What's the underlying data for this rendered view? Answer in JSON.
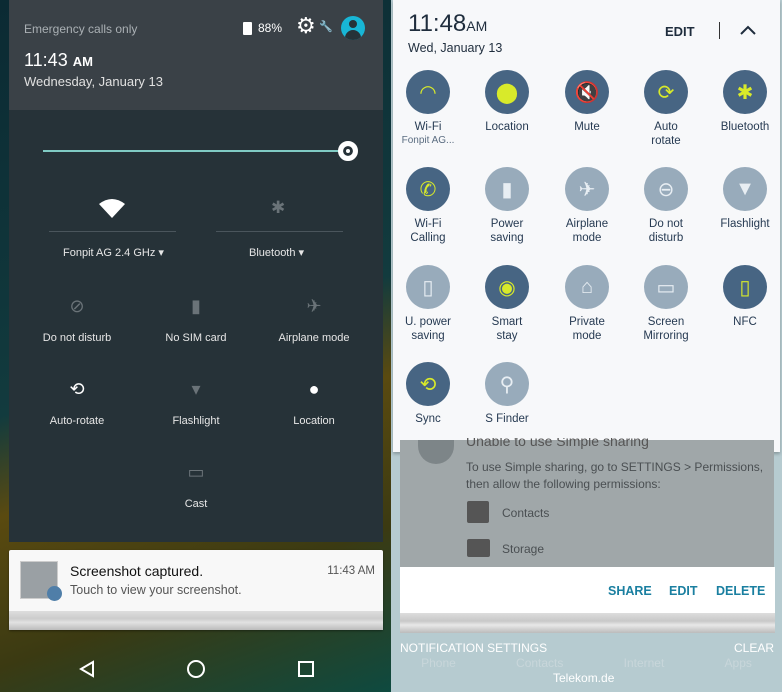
{
  "left": {
    "status": {
      "carrier": "Emergency calls only",
      "battery": "88%",
      "time": "11:43",
      "ampm": "AM",
      "date": "Wednesday, January 13"
    },
    "brightness": {
      "level": 1.0
    },
    "wifi": {
      "label": "Fonpit AG 2.4 GHz",
      "icon": "wifi-icon"
    },
    "bluetooth": {
      "label": "Bluetooth",
      "icon": "bluetooth-off-icon"
    },
    "tiles": [
      {
        "label": "Do not disturb",
        "icon": "do-not-disturb-off-icon"
      },
      {
        "label": "No SIM card",
        "icon": "no-sim-icon"
      },
      {
        "label": "Airplane mode",
        "icon": "airplane-off-icon"
      },
      {
        "label": "Auto-rotate",
        "icon": "auto-rotate-icon"
      },
      {
        "label": "Flashlight",
        "icon": "flashlight-off-icon"
      },
      {
        "label": "Location",
        "icon": "location-icon"
      },
      {
        "label": "Cast",
        "icon": "cast-icon"
      }
    ],
    "notification": {
      "title": "Screenshot captured.",
      "text": "Touch to view your screenshot.",
      "time": "11:43 AM"
    },
    "nav": [
      "back-icon",
      "home-icon",
      "recents-icon"
    ]
  },
  "right": {
    "time": "11:48",
    "ampm": "AM",
    "date": "Wed, January 13",
    "edit": "EDIT",
    "colors": {
      "active": "#476583",
      "inactive": "#98abbb",
      "icon_active": "#d8ea2a"
    },
    "tiles": [
      {
        "label": "Wi-Fi",
        "sub": "Fonpit AG...",
        "active": true,
        "icon": "wifi-icon"
      },
      {
        "label": "Location",
        "active": true,
        "icon": "location-icon"
      },
      {
        "label": "Mute",
        "active": true,
        "icon": "mute-icon"
      },
      {
        "label": "Auto rotate",
        "active": true,
        "icon": "auto-rotate-icon"
      },
      {
        "label": "Bluetooth",
        "active": true,
        "icon": "bluetooth-icon"
      },
      {
        "label": "Wi-Fi Calling",
        "active": true,
        "icon": "wifi-calling-icon"
      },
      {
        "label": "Power saving",
        "active": false,
        "icon": "power-saving-icon"
      },
      {
        "label": "Airplane mode",
        "active": false,
        "icon": "airplane-icon"
      },
      {
        "label": "Do not disturb",
        "active": false,
        "icon": "do-not-disturb-icon"
      },
      {
        "label": "Flashlight",
        "active": false,
        "icon": "flashlight-icon"
      },
      {
        "label": "U. power saving",
        "active": false,
        "icon": "ultra-power-saving-icon"
      },
      {
        "label": "Smart stay",
        "active": true,
        "icon": "smart-stay-icon"
      },
      {
        "label": "Private mode",
        "active": false,
        "icon": "private-mode-icon"
      },
      {
        "label": "Screen Mirroring",
        "active": false,
        "icon": "screen-mirroring-icon"
      },
      {
        "label": "NFC",
        "active": true,
        "icon": "nfc-icon"
      },
      {
        "label": "Sync",
        "active": true,
        "icon": "sync-icon"
      },
      {
        "label": "S Finder",
        "active": false,
        "icon": "search-icon"
      }
    ],
    "card": {
      "title": "Unable to use Simple sharing",
      "text1": "To use Simple sharing, go to SETTINGS > Permissions,",
      "text2": "then allow the following permissions:",
      "perm1": "Contacts",
      "perm2": "Storage"
    },
    "actions": {
      "share": "SHARE",
      "edit": "EDIT",
      "delete": "DELETE"
    },
    "footer": {
      "settings": "NOTIFICATION SETTINGS",
      "clear": "CLEAR",
      "carrier": "Telekom.de",
      "dock": [
        "Phone",
        "Contacts",
        "Internet",
        "Apps"
      ]
    }
  }
}
